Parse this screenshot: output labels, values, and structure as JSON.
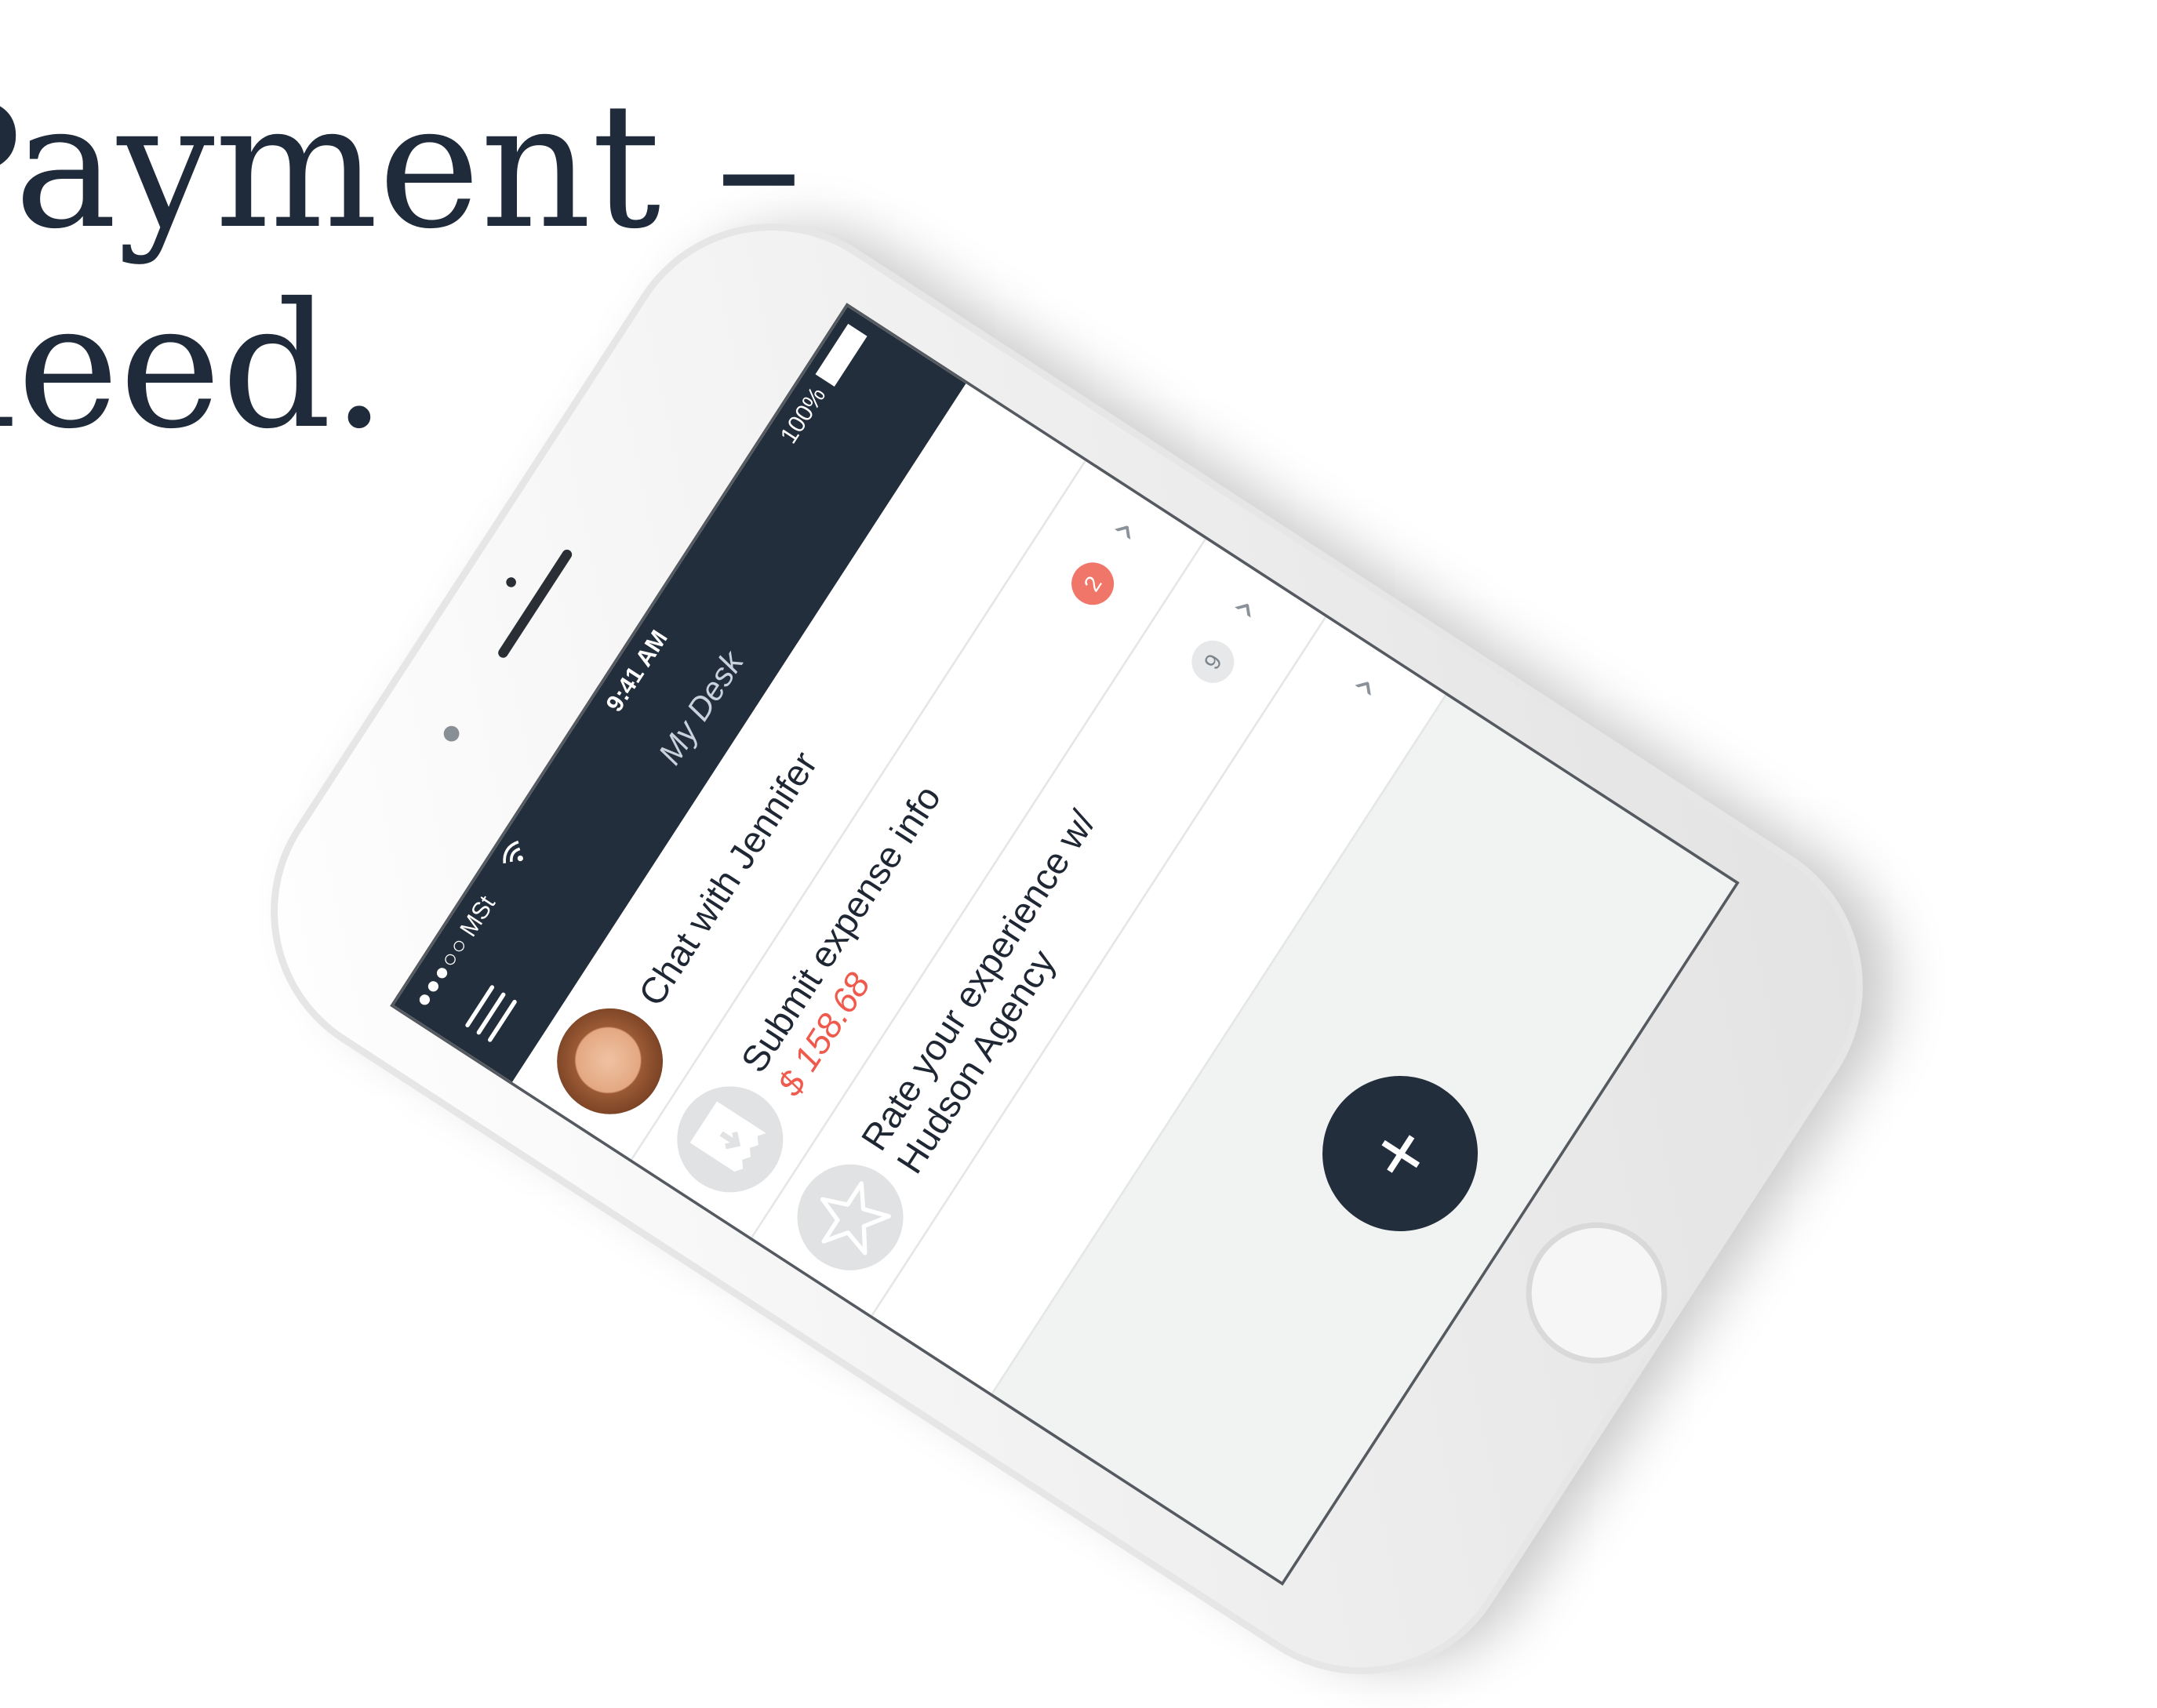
{
  "headline": {
    "line1": "Payment –",
    "line2": "need."
  },
  "status_bar": {
    "signal": "●●●○○",
    "carrier": "MSt",
    "time": "9:41 AM",
    "battery": "100%"
  },
  "navbar": {
    "title": "My Desk"
  },
  "list": [
    {
      "label": "Chat with Jennifer"
    },
    {
      "label": "Submit expense info",
      "amount": "$ 158.68",
      "badge": "2"
    },
    {
      "label_line1": "Rate your experience w/",
      "label_line2": "Hudson Agency",
      "badge": "9"
    }
  ],
  "fab": {
    "label": "+"
  },
  "colors": {
    "navbar_bg": "#222e3c",
    "accent_red": "#ef5a4c",
    "headline": "#1f2b3a"
  }
}
